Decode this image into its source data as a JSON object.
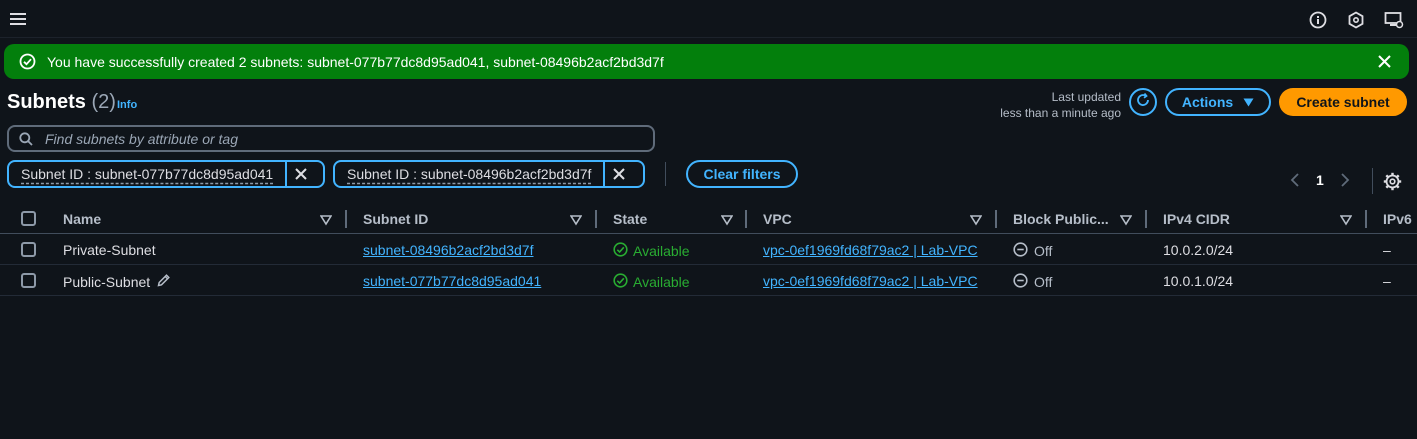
{
  "flash": {
    "message": "You have successfully created 2 subnets: subnet-077b77dc8d95ad041, subnet-08496b2acf2bd3d7f"
  },
  "header": {
    "title": "Subnets",
    "count": "(2)",
    "info": "Info",
    "last_updated_label": "Last updated",
    "last_updated_value": "less than a minute ago",
    "actions_label": "Actions",
    "create_label": "Create subnet"
  },
  "search": {
    "placeholder": "Find subnets by attribute or tag"
  },
  "filters": {
    "tokens": [
      {
        "label": "Subnet ID : subnet-077b77dc8d95ad041"
      },
      {
        "label": "Subnet ID : subnet-08496b2acf2bd3d7f"
      }
    ],
    "clear_label": "Clear filters"
  },
  "pagination": {
    "current_page": "1"
  },
  "table": {
    "columns": [
      "Name",
      "Subnet ID",
      "State",
      "VPC",
      "Block Public...",
      "IPv4 CIDR",
      "IPv6"
    ],
    "rows": [
      {
        "name": "Private-Subnet",
        "subnet_id": "subnet-08496b2acf2bd3d7f",
        "state": "Available",
        "vpc": "vpc-0ef1969fd68f79ac2 | Lab-VPC",
        "block_public": "Off",
        "ipv4_cidr": "10.0.2.0/24",
        "ipv6": "–"
      },
      {
        "name": "Public-Subnet",
        "subnet_id": "subnet-077b77dc8d95ad041",
        "state": "Available",
        "vpc": "vpc-0ef1969fd68f79ac2 | Lab-VPC",
        "block_public": "Off",
        "ipv4_cidr": "10.0.1.0/24",
        "ipv6": "–"
      }
    ]
  },
  "colors": {
    "background": "#0f141a",
    "success_flash": "#037f0c",
    "link": "#42b4ff",
    "primary_button": "#ff9900",
    "available_status": "#29ad32"
  },
  "icons": {
    "menu": "hamburger-menu-icon",
    "top_right": [
      "info-circle-icon",
      "notifications-hexagon-icon",
      "display-settings-icon"
    ],
    "flash": [
      "check-circle-icon",
      "close-icon"
    ],
    "refresh": "refresh-icon",
    "search": "search-icon",
    "pager": [
      "chevron-left-icon",
      "chevron-right-icon"
    ],
    "settings": "gear-icon",
    "sort": "caret-down-icon",
    "edit": "pencil-icon",
    "status_available": "check-circle-icon",
    "status_off": "minus-circle-icon"
  }
}
